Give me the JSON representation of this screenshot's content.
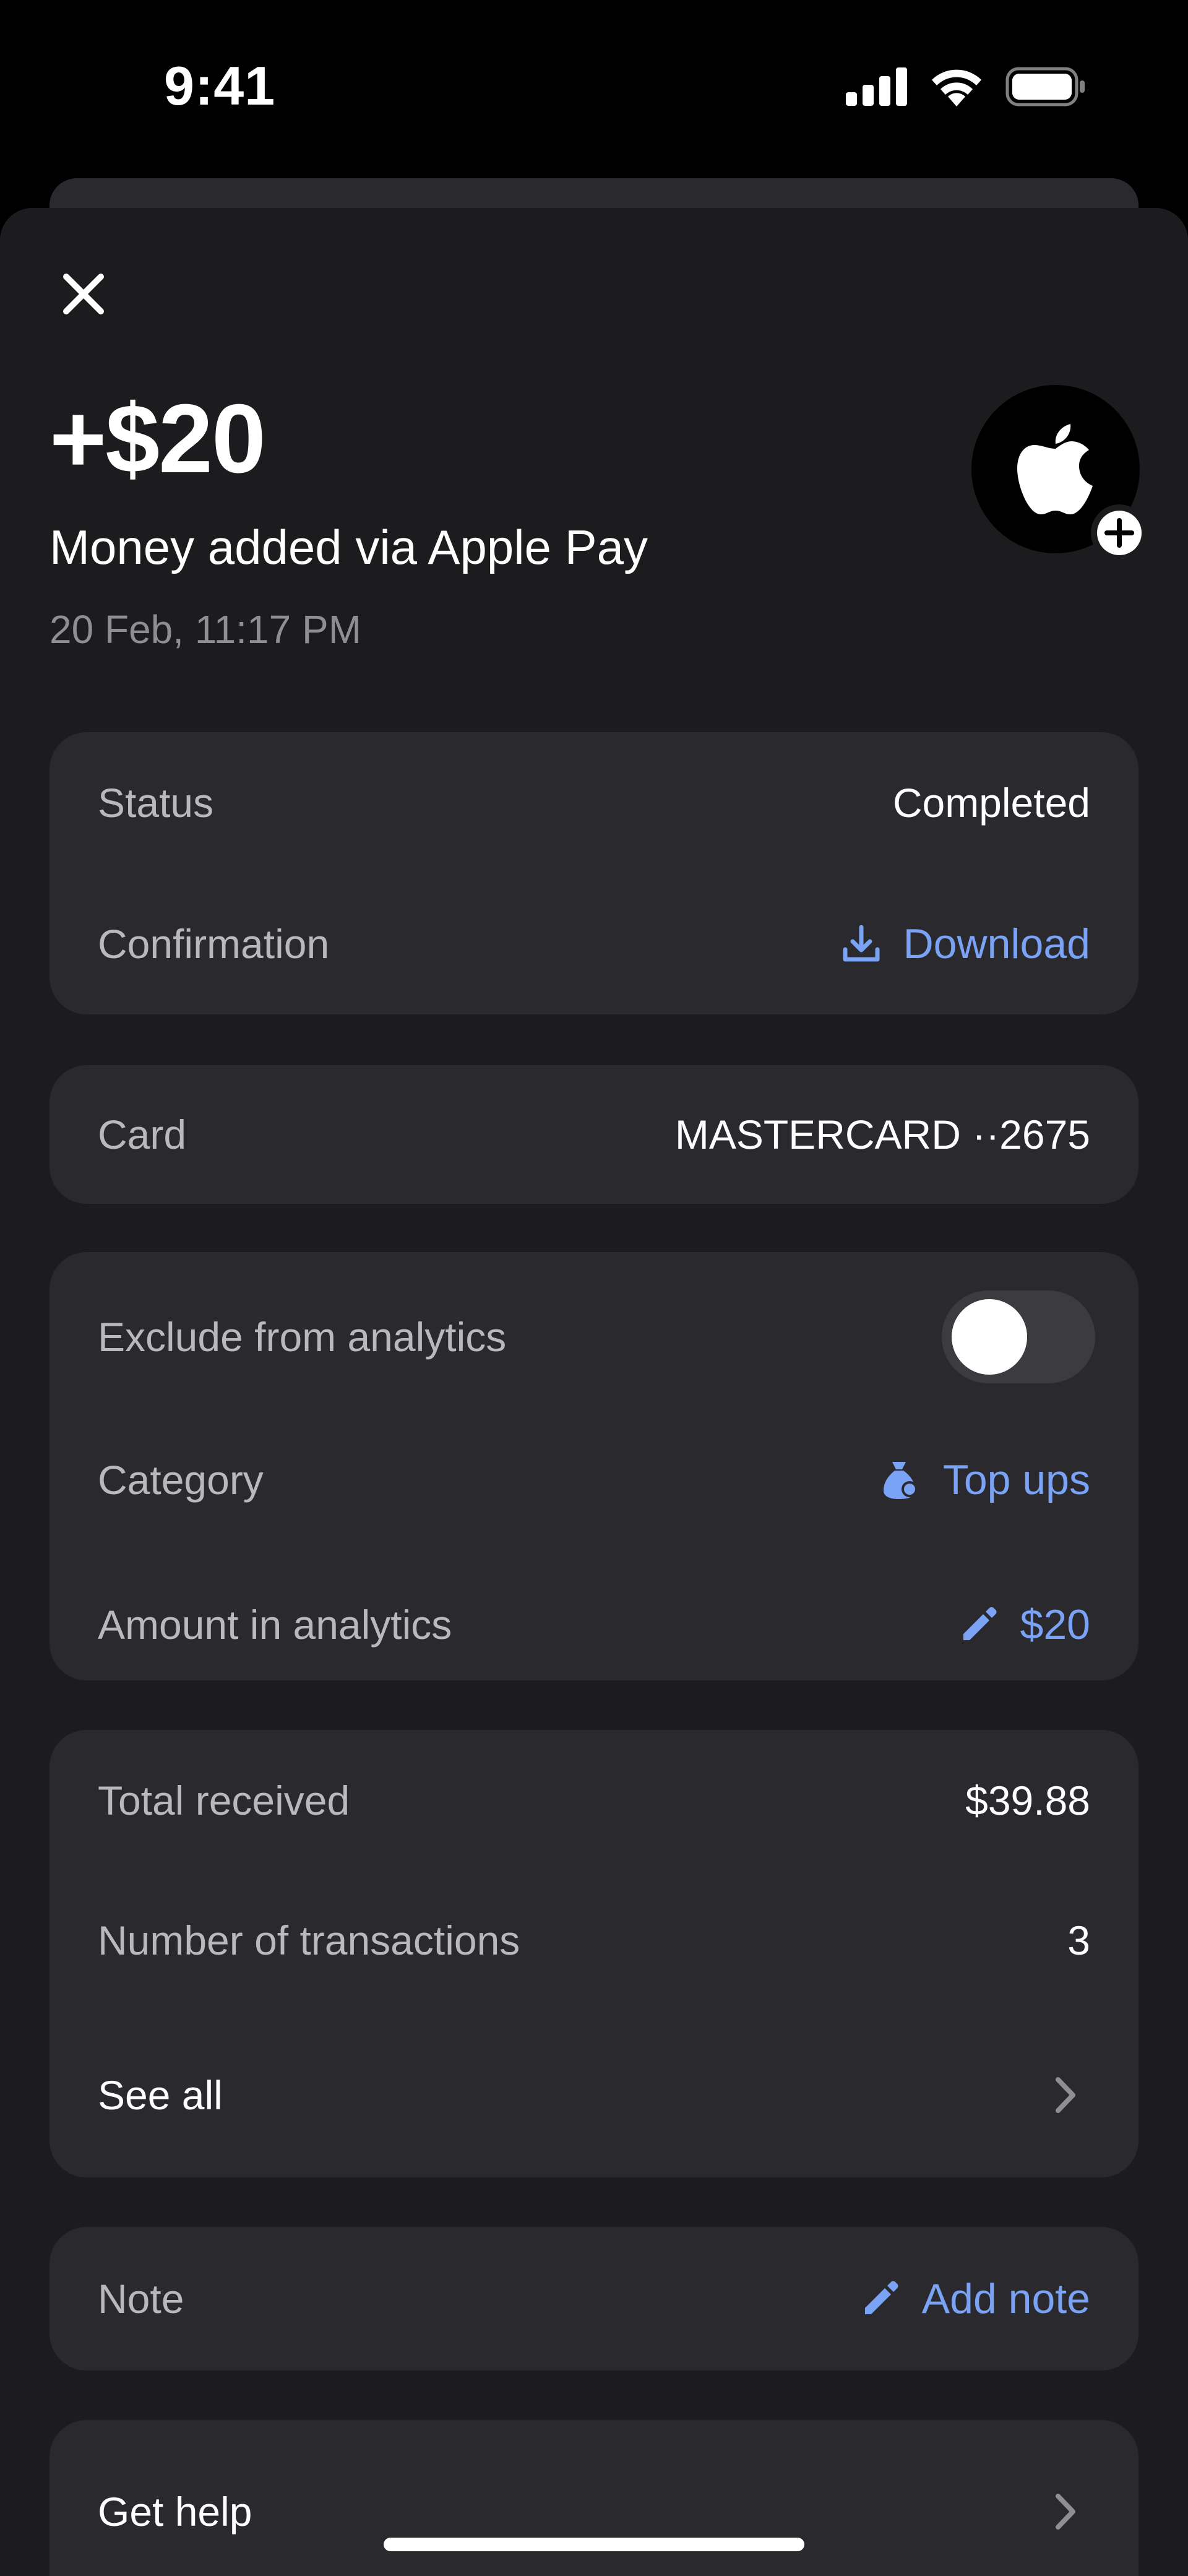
{
  "status_bar": {
    "time": "9:41"
  },
  "header": {
    "amount": "+$20",
    "title": "Money added via Apple Pay",
    "date": "20 Feb, 11:17 PM"
  },
  "details": {
    "status_label": "Status",
    "status_value": "Completed",
    "confirmation_label": "Confirmation",
    "download_label": "Download"
  },
  "card_info": {
    "label": "Card",
    "value": "MASTERCARD ··2675"
  },
  "analytics": {
    "exclude_label": "Exclude from analytics",
    "exclude_on": false,
    "category_label": "Category",
    "category_value": "Top ups",
    "amount_label": "Amount in analytics",
    "amount_value": "$20"
  },
  "summary": {
    "total_label": "Total received",
    "total_value": "$39.88",
    "count_label": "Number of transactions",
    "count_value": "3",
    "see_all_label": "See all"
  },
  "note": {
    "label": "Note",
    "action": "Add note"
  },
  "help": {
    "label": "Get help"
  },
  "colors": {
    "accent": "#7aa3f5",
    "sheet_bg": "#1c1c1e",
    "card_bg": "#2a2a2e"
  }
}
